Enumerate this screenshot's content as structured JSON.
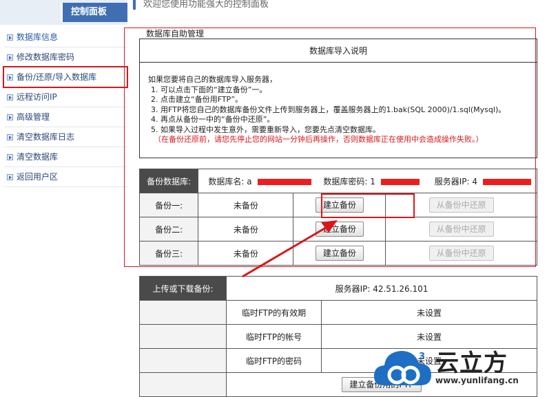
{
  "sidebar": {
    "title": "控制面板",
    "items": [
      {
        "label": "数据库信息"
      },
      {
        "label": "修改数据库密码"
      },
      {
        "label": "备份/还原/导入数据库"
      },
      {
        "label": "远程访问IP"
      },
      {
        "label": "高级管理"
      },
      {
        "label": "清空数据库日志"
      },
      {
        "label": "清空数据库"
      },
      {
        "label": "返回用户区"
      }
    ]
  },
  "header": {
    "welcome": "欢迎您使用功能强大的控制面板"
  },
  "manage": {
    "title": "数据库自助管理",
    "import_heading": "数据库导入说明",
    "instructions": [
      "如果您要将自己的数据库导入服务器，",
      "1. 可以点击下面的“建立备份”一。",
      "2. 点击建立“备份用FTP”。",
      "3. 用FTP将您自己的数据库备份文件上传到服务器上，覆盖服务器上的1.bak(SQL 2000)/1.sql(Mysql)。",
      "4. 再点从备份一中的“备份中还原”。",
      "5. 如果导入过程中发生意外，需要重新导入，您要先点清空数据库。"
    ],
    "warning": "（在备份还原前，请您先停止您的网站一分钟后再操作，否则数据库正在使用中会造成操作失败。）"
  },
  "backup": {
    "header_label": "备份数据库:",
    "db_name_label": "数据库名: a",
    "db_password_label": "数据库密码: 1",
    "server_ip_label": "服务器IP: 4",
    "rows": [
      {
        "label": "备份一:",
        "status": "未备份",
        "create": "建立备份",
        "restore": "从备份中还原"
      },
      {
        "label": "备份二:",
        "status": "未备份",
        "create": "建立备份",
        "restore": "从备份中还原"
      },
      {
        "label": "备份三:",
        "status": "未备份",
        "create": "建立备份",
        "restore": "从备份中还原"
      }
    ]
  },
  "transfer": {
    "header_label": "上传或下载备份:",
    "server_ip": "服务器IP: 42.51.26.101",
    "rows": [
      {
        "label": "临时FTP的有效期",
        "value": "未设置"
      },
      {
        "label": "临时FTP的帐号",
        "value": "未设置"
      },
      {
        "label": "临时FTP的密码",
        "value": "未设置"
      }
    ],
    "ftp_button": "建立备份用的FTP"
  },
  "watermark": {
    "brand": "云立方",
    "url": "www.yunlifang.cn",
    "logo_mark": "3"
  },
  "colors": {
    "accent": "#3f6fb2",
    "highlight": "#d9161b",
    "redaction": "#ee1c1c",
    "dark_cell": "#4a4a4a"
  }
}
